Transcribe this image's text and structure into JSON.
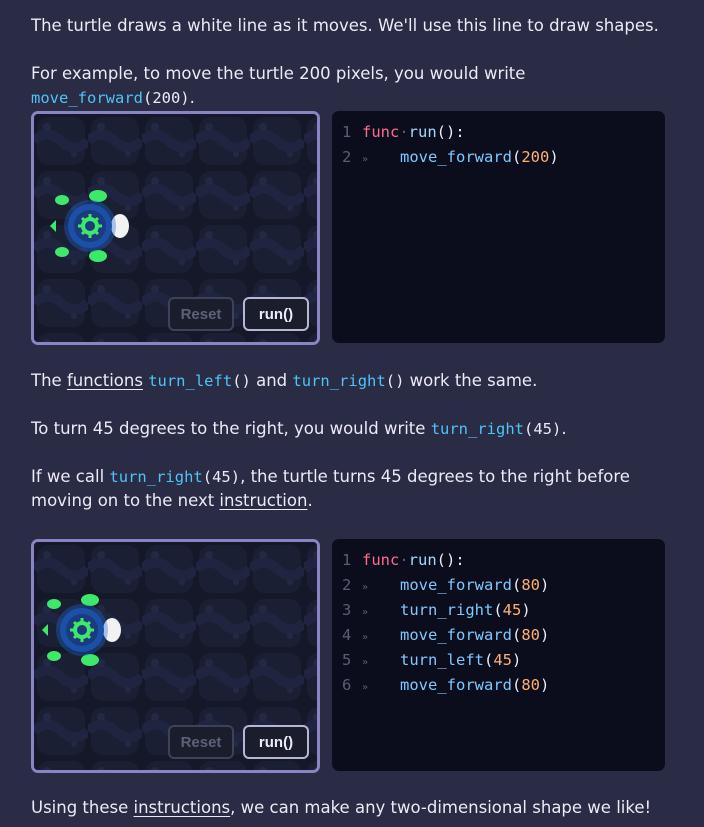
{
  "intro_text": "The turtle draws a white line as it moves. We'll use this line to draw shapes.",
  "example": {
    "prefix": "For example, to move the turtle 200 pixels, you would write ",
    "code_fn": "move_forward",
    "code_args": "(200)",
    "suffix": "."
  },
  "demo1": {
    "reset_label": "Reset",
    "run_label": "run()",
    "code": {
      "line1": {
        "num": "1",
        "kw": "func",
        "name": "run",
        "rest": "():"
      },
      "line2": {
        "num": "2",
        "tab": "»",
        "fn": "move_forward",
        "open": "(",
        "arg": "200",
        "close": ")"
      }
    }
  },
  "functions_para": {
    "p1": "The ",
    "link": "functions",
    "p2": " ",
    "fn1": "turn_left",
    "fn1_args": "()",
    "p3": " and ",
    "fn2": "turn_right",
    "fn2_args": "()",
    "p4": " work the same."
  },
  "turn_para": {
    "prefix": "To turn 45 degrees to the right, you would write ",
    "fn": "turn_right",
    "args": "(45)",
    "suffix": "."
  },
  "call_para": {
    "p1": "If we call ",
    "fn": "turn_right",
    "args": "(45)",
    "p2": ", the turtle turns 45 degrees to the right before",
    "p3": "moving on to the next ",
    "link": "instruction",
    "p4": "."
  },
  "demo2": {
    "reset_label": "Reset",
    "run_label": "run()",
    "code": {
      "line1": {
        "num": "1",
        "kw": "func",
        "name": "run",
        "rest": "():"
      },
      "line2": {
        "num": "2",
        "tab": "»",
        "fn": "move_forward",
        "open": "(",
        "arg": "80",
        "close": ")"
      },
      "line3": {
        "num": "3",
        "tab": "»",
        "fn": "turn_right",
        "open": "(",
        "arg": "45",
        "close": ")"
      },
      "line4": {
        "num": "4",
        "tab": "»",
        "fn": "move_forward",
        "open": "(",
        "arg": "80",
        "close": ")"
      },
      "line5": {
        "num": "5",
        "tab": "»",
        "fn": "turn_left",
        "open": "(",
        "arg": "45",
        "close": ")"
      },
      "line6": {
        "num": "6",
        "tab": "»",
        "fn": "move_forward",
        "open": "(",
        "arg": "80",
        "close": ")"
      }
    }
  },
  "outro": {
    "p1": "Using these ",
    "link": "instructions",
    "p2": ", we can make any two-dimensional shape we like!"
  },
  "colors": {
    "background": "#2a2b45",
    "accent_code": "#4fc3f7",
    "keyword": "#ff6b8b",
    "number": "#ffb070",
    "turtle": "#3ee86a"
  }
}
